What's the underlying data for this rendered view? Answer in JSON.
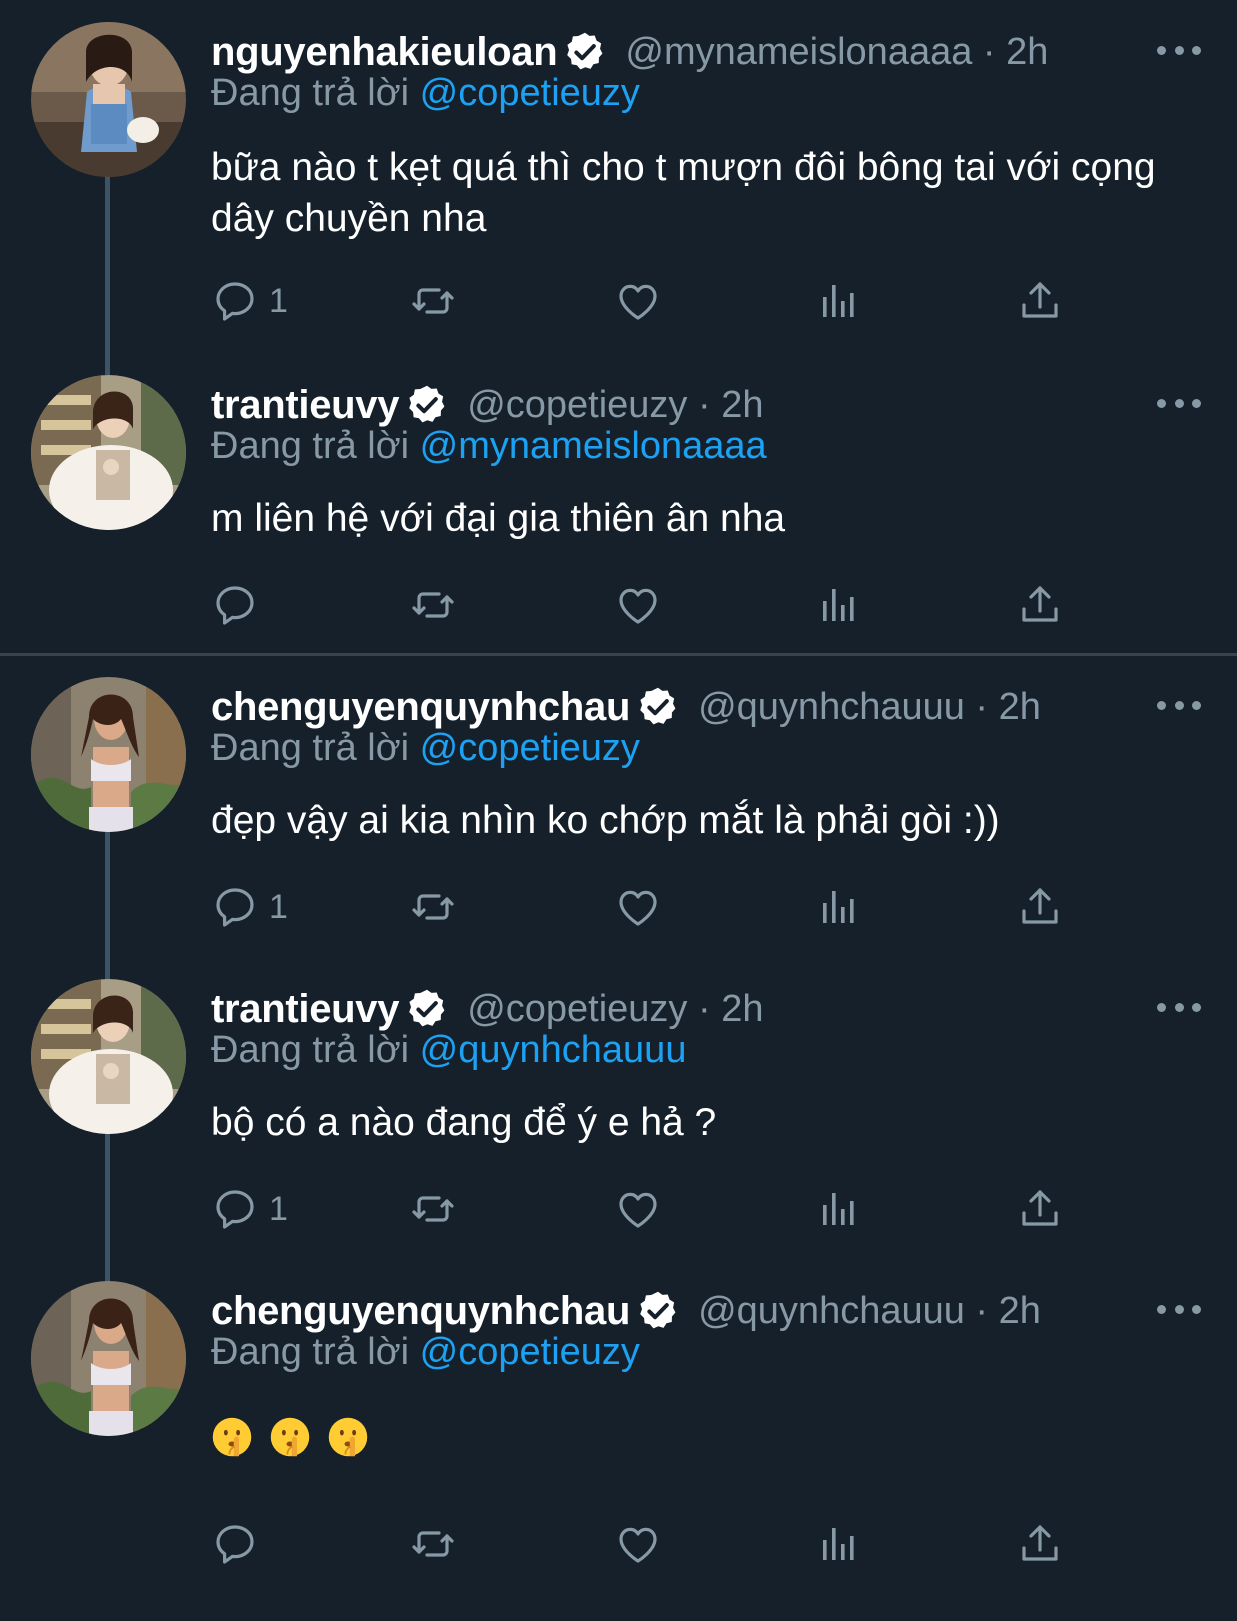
{
  "colors": {
    "background": "#15202b",
    "secondary_text": "#8899a6",
    "mention": "#1da1f2",
    "thread_line": "#3d5466"
  },
  "replying_prefix": "Đang trả lời",
  "tweets": [
    {
      "name": "nguyenhakieuloan",
      "handle": "@mynameislonaaaa · 2h",
      "reply_to": "@copetieuzy",
      "text": "bữa nào t kẹt quá thì cho t mượn đôi bông tai với cọng dây chuyền nha",
      "reply_count": "1"
    },
    {
      "name": "trantieuvy",
      "handle": "@copetieuzy · 2h",
      "reply_to": "@mynameislonaaaa",
      "text": "m liên hệ với đại gia thiên ân nha",
      "reply_count": ""
    },
    {
      "name": "chenguyenquynhchau",
      "handle": "@quynhchauuu · 2h",
      "reply_to": "@copetieuzy",
      "text": "đẹp vậy ai kia nhìn ko chớp mắt là phải gòi :))",
      "reply_count": "1"
    },
    {
      "name": "trantieuvy",
      "handle": "@copetieuzy · 2h",
      "reply_to": "@quynhchauuu",
      "text": "bộ có a nào đang để ý e hả ?",
      "reply_count": "1"
    },
    {
      "name": "chenguyenquynhchau",
      "handle": "@quynhchauuu · 2h",
      "reply_to": "@copetieuzy",
      "text": "",
      "emoji": [
        "shushing-face",
        "shushing-face",
        "shushing-face"
      ],
      "reply_count": ""
    }
  ],
  "icons": {
    "reply": "reply-icon",
    "retweet": "retweet-icon",
    "like": "heart-icon",
    "views": "analytics-icon",
    "share": "share-icon",
    "verified": "verified-badge-icon",
    "more": "more-icon"
  }
}
